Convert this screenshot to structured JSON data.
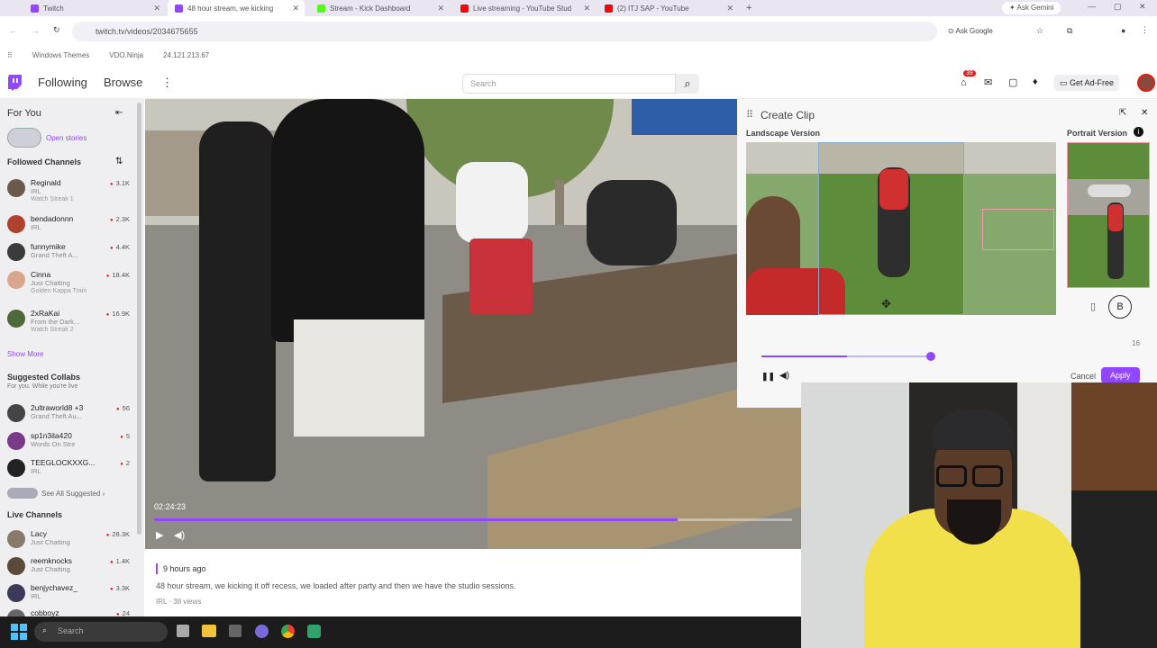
{
  "browser": {
    "tabs": [
      {
        "label": "Twitch",
        "fav": "#9146ff",
        "active": false
      },
      {
        "label": "48 hour stream, we kicking",
        "fav": "#9146ff",
        "active": true
      },
      {
        "label": "Stream - Kick Dashboard",
        "fav": "#53fc18",
        "active": false
      },
      {
        "label": "Live streaming - YouTube Stud",
        "fav": "#ff0000",
        "active": false
      },
      {
        "label": "(2) ITJ SAP - YouTube",
        "fav": "#ff0000",
        "active": false
      }
    ],
    "ask_gemini": "Ask Gemini",
    "url": "twitch.tv/videos/2034675655",
    "ask_google": "Ask Google",
    "bookmarks": [
      "Windows Themes",
      "VDO.Ninja",
      "24.121.213.67"
    ]
  },
  "twitch": {
    "nav_following": "Following",
    "nav_browse": "Browse",
    "search_placeholder": "Search",
    "notif_count": "39",
    "get_ad_free": "Get Ad-Free"
  },
  "sidebar": {
    "for_you": "For You",
    "open_stories": "Open stories",
    "followed_channels": "Followed Channels",
    "followed": [
      {
        "name": "Reginald",
        "game": "IRL",
        "sub": "Watch Streak 1",
        "viewers": "3.1K",
        "color": "#6a5a4a"
      },
      {
        "name": "bendadonnn",
        "game": "IRL",
        "sub": "",
        "viewers": "2.3K",
        "color": "#b0412f"
      },
      {
        "name": "funnymike",
        "game": "Grand Theft A...",
        "sub": "",
        "viewers": "4.4K",
        "color": "#3b3b3b"
      },
      {
        "name": "Cinna",
        "game": "Just Chatting",
        "sub": "Golden Kappa Train",
        "viewers": "18.4K",
        "color": "#d9a68c"
      },
      {
        "name": "2xRaKai",
        "game": "From the Dark...",
        "sub": "Watch Streak 2",
        "viewers": "16.9K",
        "color": "#4f6a3a"
      }
    ],
    "show_more": "Show More",
    "suggested_collabs": "Suggested Collabs",
    "suggested_sub": "For you. While you're live",
    "suggested": [
      {
        "name": "2ultraworld8 +3",
        "game": "Grand Theft Au...",
        "viewers": "56",
        "color": "#444"
      },
      {
        "name": "sp1n3ila420",
        "game": "Words On Stre",
        "viewers": "5",
        "color": "#7a3a8a"
      },
      {
        "name": "TEEGLOCKXXG...",
        "game": "IRL",
        "viewers": "2",
        "color": "#222"
      }
    ],
    "see_all_suggested": "See All Suggested",
    "live_channels": "Live Channels",
    "live": [
      {
        "name": "Lacy",
        "game": "Just Chatting",
        "viewers": "28.3K",
        "color": "#8a7a6a"
      },
      {
        "name": "reemknocks",
        "game": "Just Chatting",
        "viewers": "1.4K",
        "color": "#5a4a3a"
      },
      {
        "name": "benjychavez_",
        "game": "IRL",
        "viewers": "3.3K",
        "color": "#3a3a5a"
      },
      {
        "name": "cobboyz",
        "game": "",
        "viewers": "24",
        "color": "#666"
      }
    ]
  },
  "video": {
    "timestamp": "02:24:23",
    "progress": 0.82
  },
  "desc": {
    "time_ago": "9 hours ago",
    "title": "48 hour stream, we kicking it off recess, we loaded after party and then we have the studio sessions.",
    "meta": "IRL · 38 views"
  },
  "clip": {
    "title": "Create Clip",
    "landscape": "Landscape Version",
    "portrait": "Portrait Version",
    "duration": "16",
    "slider": 0.5,
    "cancel": "Cancel",
    "apply": "Apply"
  },
  "taskbar": {
    "search_placeholder": "Search"
  }
}
